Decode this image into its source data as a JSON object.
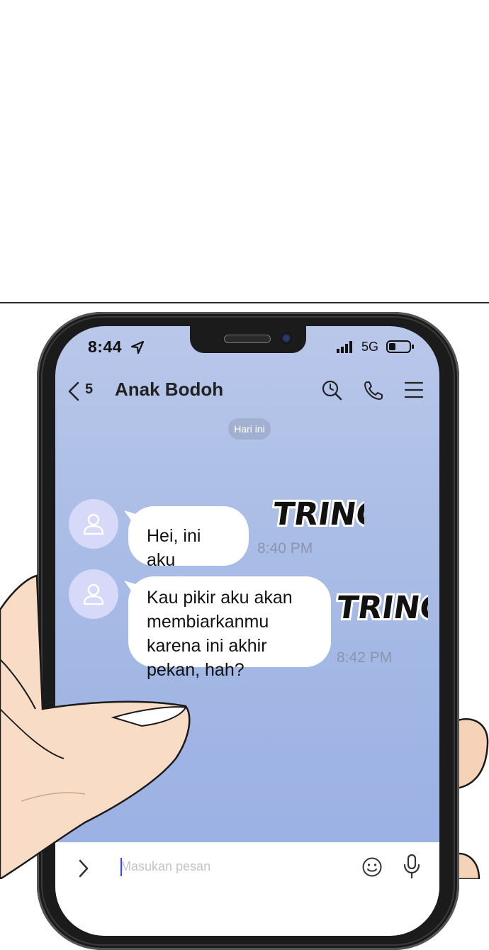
{
  "status_bar": {
    "time": "8:44",
    "network": "5G"
  },
  "header": {
    "unread_count": "5",
    "title": "Anak Bodoh"
  },
  "date_separator": "Hari ini",
  "messages": [
    {
      "text": "Hei, ini aku",
      "time": "8:40 PM"
    },
    {
      "text": "Kau pikir aku akan membiarkanmu karena ini akhir pekan, hah?",
      "time": "8:42 PM"
    }
  ],
  "sound_effects": [
    "TRING",
    "TRING"
  ],
  "input": {
    "placeholder": "Masukan pesan"
  },
  "icons": {
    "back": "chevron-left-icon",
    "search": "clock-search-icon",
    "call": "phone-icon",
    "menu": "hamburger-menu-icon",
    "expand": "chevron-right-icon",
    "emoji": "smiley-icon",
    "voice": "microphone-icon",
    "avatar": "person-icon"
  },
  "colors": {
    "chat_background": "#aabde6",
    "bubble": "#ffffff",
    "avatar": "#d6d9f7",
    "timestamp": "#8a94ad"
  }
}
